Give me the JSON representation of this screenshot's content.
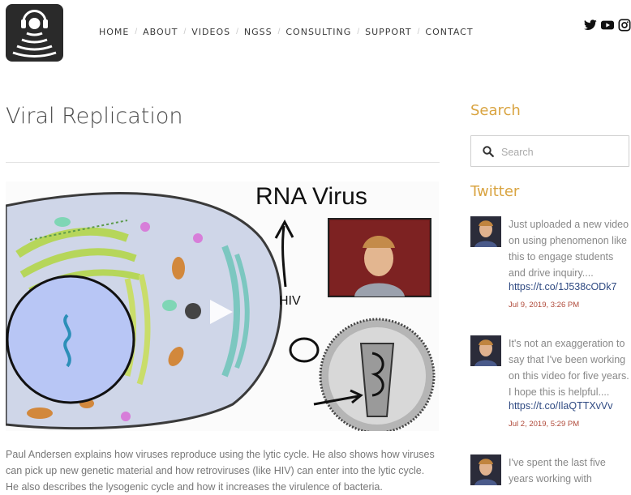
{
  "header": {
    "nav": [
      {
        "label": "HOME"
      },
      {
        "label": "ABOUT"
      },
      {
        "label": "VIDEOS"
      },
      {
        "label": "NGSS"
      },
      {
        "label": "CONSULTING"
      },
      {
        "label": "SUPPORT"
      },
      {
        "label": "CONTACT"
      }
    ],
    "separator": "/",
    "social_icons": [
      "twitter-icon",
      "youtube-icon",
      "instagram-icon"
    ]
  },
  "main": {
    "title": "Viral Replication",
    "video": {
      "overlay_title": "RNA Virus",
      "label_hiv": "HIV"
    },
    "description": "Paul Andersen explains how viruses reproduce using the lytic cycle. He also shows how viruses can pick up new genetic material and how retroviruses (like HIV) can enter into the lytic cycle. He also describes the lysogenic cycle and how it increases the virulence of bacteria."
  },
  "sidebar": {
    "search_title": "Search",
    "search_placeholder": "Search",
    "twitter_title": "Twitter",
    "tweets": [
      {
        "text": "Just uploaded a new video on using phenomenon like this to engage students and drive inquiry....",
        "link": "https://t.co/1J538cODk7",
        "date": "Jul 9, 2019, 3:26 PM"
      },
      {
        "text": "It's not an exaggeration to say that I've been working on this video for five years. I hope this is helpful....",
        "link": "https://t.co/IlaQTTXvVv",
        "date": "Jul 2, 2019, 5:29 PM"
      },
      {
        "text": "I've spent the last five years working with",
        "link": "",
        "date": ""
      }
    ]
  },
  "colors": {
    "accent": "#d9a441",
    "link": "#2f4a82",
    "date": "#b04a3a",
    "logo_bg": "#2a2a2a"
  }
}
